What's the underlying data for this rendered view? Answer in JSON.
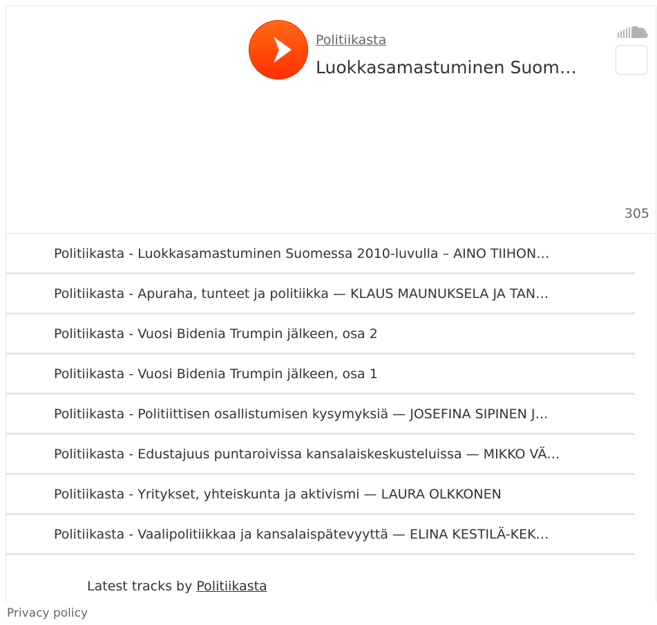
{
  "player": {
    "user": "Politiikasta",
    "title": "Luokkasamastuminen Suom…",
    "play_count": "305",
    "accent_color": "#ff5500",
    "icons": [
      "play-icon",
      "soundcloud-logo-icon",
      "like-icon"
    ]
  },
  "tracks": [
    {
      "label": "Politiikasta - Luokkasamastuminen Suomessa 2010-luvulla – AINO TIIHON…"
    },
    {
      "label": "Politiikasta - Apuraha, tunteet ja politiikka — KLAUS MAUNUKSELA JA TAN…"
    },
    {
      "label": "Politiikasta - Vuosi Bidenia Trumpin jälkeen, osa 2"
    },
    {
      "label": "Politiikasta - Vuosi Bidenia Trumpin jälkeen, osa 1"
    },
    {
      "label": "Politiikasta - Politiittisen osallistumisen kysymyksiä — JOSEFINA SIPINEN J…"
    },
    {
      "label": "Politiikasta - Edustajuus puntaroivissa kansalaiskeskusteluissa — MIKKO VÄ…"
    },
    {
      "label": "Politiikasta - Yritykset, yhteiskunta ja aktivismi — LAURA OLKKONEN"
    },
    {
      "label": "Politiikasta - Vaalipolitiikkaa ja kansalaispätevyyttä — ELINA KESTILÄ-KEK…"
    }
  ],
  "footer": {
    "latest_prefix": "Latest tracks by ",
    "latest_user": "Politiikasta",
    "privacy": "Privacy policy"
  }
}
